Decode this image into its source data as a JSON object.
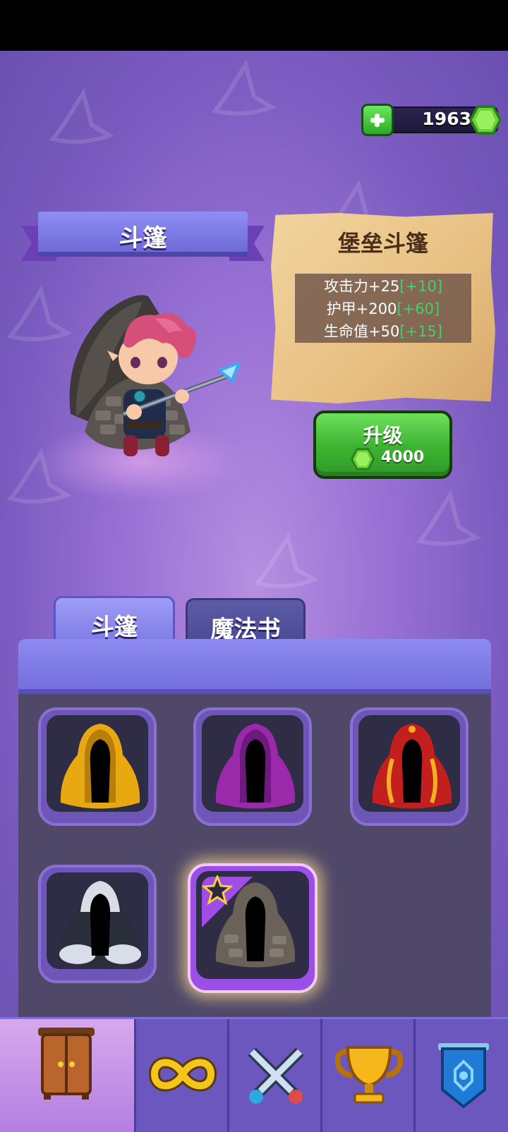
{
  "currency": {
    "gems": "1963",
    "add_button": "plus-icon",
    "gem_icon": "gem-icon"
  },
  "banner": {
    "label": "斗篷"
  },
  "item": {
    "name": "堡垒斗篷",
    "stats": [
      {
        "text": "攻击力+25",
        "bonus": "[+10]"
      },
      {
        "text": "护甲+200",
        "bonus": "[+60]"
      },
      {
        "text": "生命值+50",
        "bonus": "[+15]"
      }
    ]
  },
  "upgrade": {
    "label": "升级",
    "cost": "4000"
  },
  "tabs": [
    {
      "label": "斗篷",
      "active": true
    },
    {
      "label": "魔法书",
      "active": false
    }
  ],
  "slots": [
    {
      "name": "yellow-cloak",
      "color": "#e8a812"
    },
    {
      "name": "purple-cloak",
      "color": "#9a2aaa"
    },
    {
      "name": "red-cloak",
      "color": "#c41f1f"
    },
    {
      "name": "white-cloak",
      "color": "#d8dde8"
    },
    {
      "name": "fortress-cloak",
      "color": "#6a6258",
      "selected": true,
      "equipped": true
    }
  ],
  "nav": [
    {
      "name": "wardrobe-icon",
      "active": true
    },
    {
      "name": "infinity-icon"
    },
    {
      "name": "crossed-swords-icon"
    },
    {
      "name": "trophy-icon"
    },
    {
      "name": "shield-banner-icon"
    }
  ],
  "colors": {
    "accent": "#7f7ce6",
    "green": "#3cb232",
    "bonus": "#3fd26a",
    "gem": "#6bd23a"
  }
}
